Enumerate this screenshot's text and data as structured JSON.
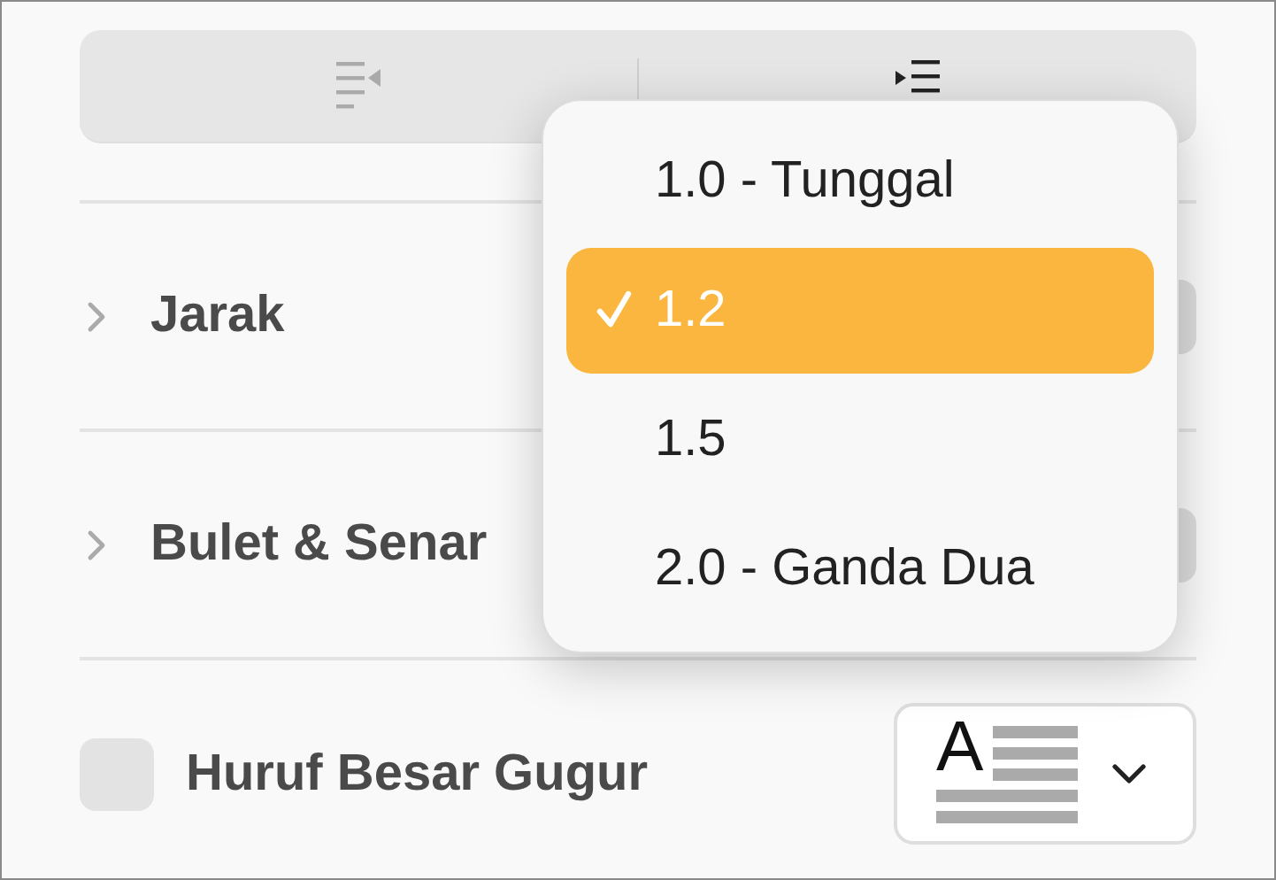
{
  "alignment_buttons": [
    {
      "kind": "outdent",
      "disabled": true
    },
    {
      "kind": "indent",
      "disabled": false
    }
  ],
  "sections": [
    {
      "label": "Jarak",
      "expanded": false
    },
    {
      "label": "Bulet & Senar",
      "expanded": false
    }
  ],
  "line_spacing_menu": {
    "items": [
      {
        "label": "1.0 - Tunggal",
        "selected": false
      },
      {
        "label": "1.2",
        "selected": true
      },
      {
        "label": "1.5",
        "selected": false
      },
      {
        "label": "2.0 - Ganda Dua",
        "selected": false
      }
    ]
  },
  "drop_cap": {
    "label": "Huruf Besar Gugur",
    "checked": false,
    "style_glyph": "A"
  }
}
